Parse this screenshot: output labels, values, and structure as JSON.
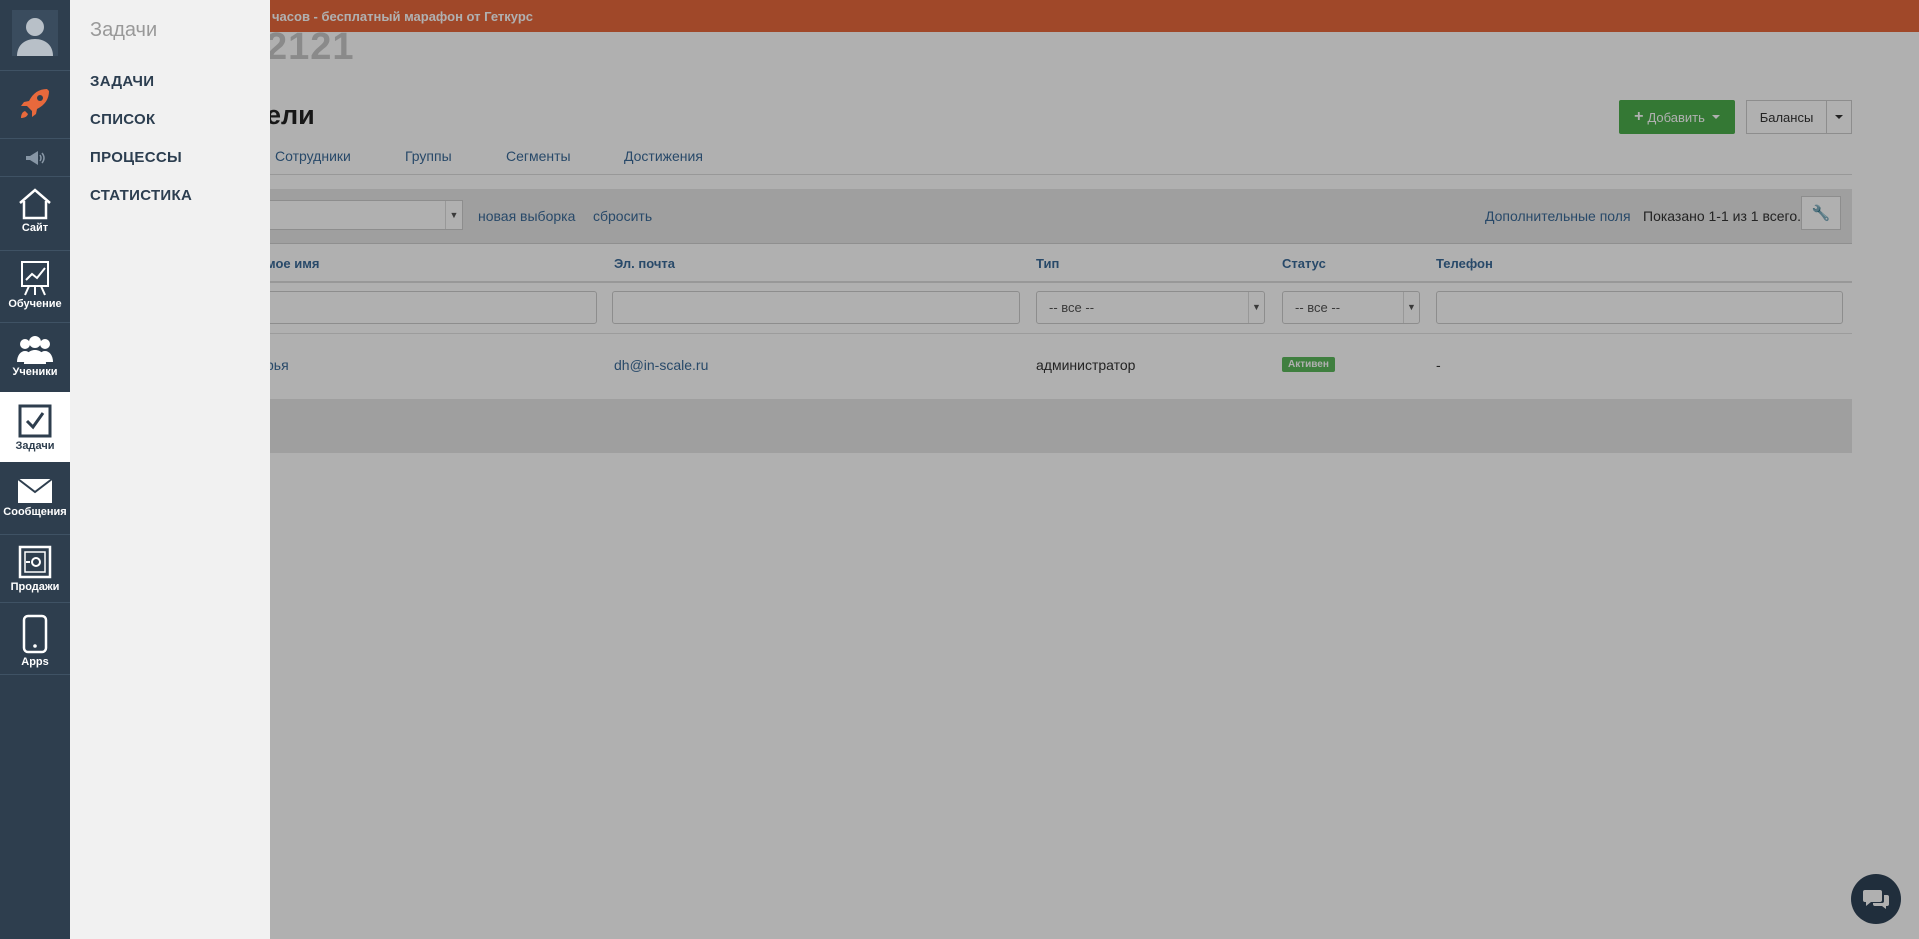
{
  "banner": {
    "text": "часов - бесплатный марафон от Геткурс"
  },
  "page": {
    "big_id": "2121",
    "title": "ели"
  },
  "toolbar": {
    "add_label": "Добавить",
    "balances_label": "Балансы"
  },
  "tabs": [
    {
      "label": "Сотрудники"
    },
    {
      "label": "Группы"
    },
    {
      "label": "Сегменты"
    },
    {
      "label": "Достижения"
    }
  ],
  "filter": {
    "new_selection": "новая выборка",
    "reset": "сбросить",
    "extra_fields": "Дополнительные поля",
    "shown": "Показано 1-1 из 1 всего."
  },
  "table": {
    "headers": [
      "мое имя",
      "Эл. почта",
      "Тип",
      "Статус",
      "Телефон"
    ],
    "filters": {
      "type_all": "-- все --",
      "status_all": "-- все --"
    },
    "rows": [
      {
        "name": "рья",
        "email": "dh@in-scale.ru",
        "type": "администратор",
        "status": "Активен",
        "phone": "-"
      }
    ]
  },
  "sidebar": {
    "items": [
      {
        "label": "Сайт",
        "icon": "home-icon"
      },
      {
        "label": "Обучение",
        "icon": "chart-icon"
      },
      {
        "label": "Ученики",
        "icon": "users-icon"
      },
      {
        "label": "Задачи",
        "icon": "checkbox-icon"
      },
      {
        "label": "Сообщения",
        "icon": "envelope-icon"
      },
      {
        "label": "Продажи",
        "icon": "safe-icon"
      },
      {
        "label": "Apps",
        "icon": "phone-icon"
      }
    ],
    "active": "Задачи",
    "accent": "#e8693c"
  },
  "submenu": {
    "title": "Задачи",
    "items": [
      {
        "label": "ЗАДАЧИ"
      },
      {
        "label": "СПИСОК"
      },
      {
        "label": "ПРОЦЕССЫ"
      },
      {
        "label": "СТАТИСТИКА"
      }
    ]
  },
  "colors": {
    "banner": "#e8693c",
    "sidebar": "#2e3e4e",
    "link": "#3b6b99",
    "success": "#4cae4c"
  }
}
